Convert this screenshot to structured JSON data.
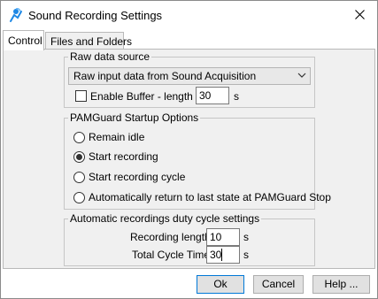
{
  "window": {
    "title": "Sound Recording Settings"
  },
  "tabs": [
    {
      "label": "Control"
    },
    {
      "label": "Files and Folders"
    }
  ],
  "raw_data": {
    "title": "Raw data source",
    "selected_source": "Raw input data from Sound Acquisition",
    "buffer_label": "Enable Buffer - length",
    "buffer_checked": false,
    "buffer_value": "30",
    "buffer_unit": "s"
  },
  "startup": {
    "title": "PAMGuard Startup Options",
    "options": [
      {
        "label": "Remain idle",
        "selected": false
      },
      {
        "label": "Start recording",
        "selected": true
      },
      {
        "label": "Start recording cycle",
        "selected": false
      },
      {
        "label": "Automatically return to last state at PAMGuard Stop",
        "selected": false
      }
    ]
  },
  "duty_cycle": {
    "title": "Automatic recordings duty cycle settings",
    "length_label": "Recording length",
    "length_value": "10",
    "length_unit": "s",
    "cycle_label": "Total Cycle Time",
    "cycle_value": "30",
    "cycle_unit": "s"
  },
  "buttons": {
    "ok": "Ok",
    "cancel": "Cancel",
    "help": "Help ..."
  },
  "colors": {
    "accent": "#0078d7",
    "app_icon": "#1e88e5"
  }
}
